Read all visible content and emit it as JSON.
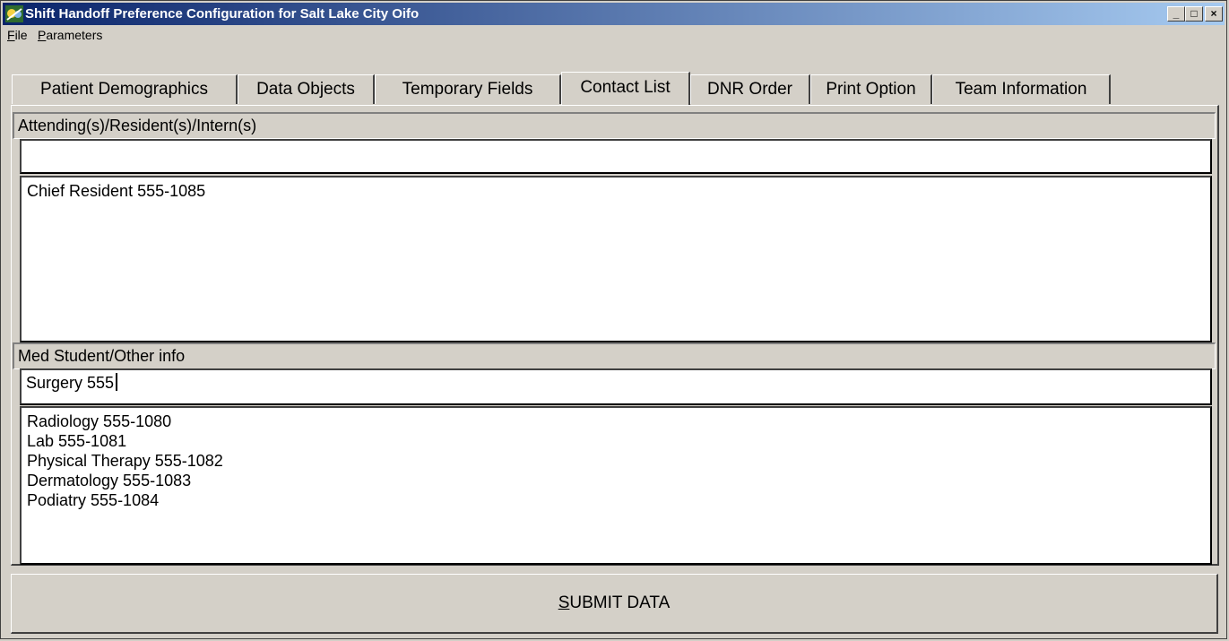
{
  "window": {
    "title": "Shift Handoff Preference Configuration for Salt Lake City Oifo",
    "controls": {
      "minimize": "_",
      "maximize": "□",
      "close": "×"
    }
  },
  "menu": {
    "items": [
      {
        "label": "File",
        "accel": "F",
        "rest": "ile"
      },
      {
        "label": "Parameters",
        "accel": "P",
        "rest": "arameters"
      }
    ]
  },
  "tabs": [
    {
      "label": "Patient Demographics",
      "active": false
    },
    {
      "label": "Data Objects",
      "active": false
    },
    {
      "label": "Temporary Fields",
      "active": false
    },
    {
      "label": "Contact List",
      "active": true
    },
    {
      "label": "DNR Order",
      "active": false
    },
    {
      "label": "Print Option",
      "active": false
    },
    {
      "label": "Team Information",
      "active": false
    }
  ],
  "contact_list": {
    "attending": {
      "label": "Attending(s)/Resident(s)/Intern(s)",
      "input_value": "",
      "list": [
        "Chief Resident 555-1085"
      ]
    },
    "med_student": {
      "label": "Med Student/Other info",
      "input_value": "Surgery 555",
      "list": [
        "Radiology 555-1080",
        "Lab 555-1081",
        "Physical Therapy 555-1082",
        "Dermatology 555-1083",
        "Podiatry 555-1084"
      ]
    }
  },
  "submit": {
    "accel": "S",
    "rest": "UBMIT DATA",
    "label": "SUBMIT DATA"
  }
}
